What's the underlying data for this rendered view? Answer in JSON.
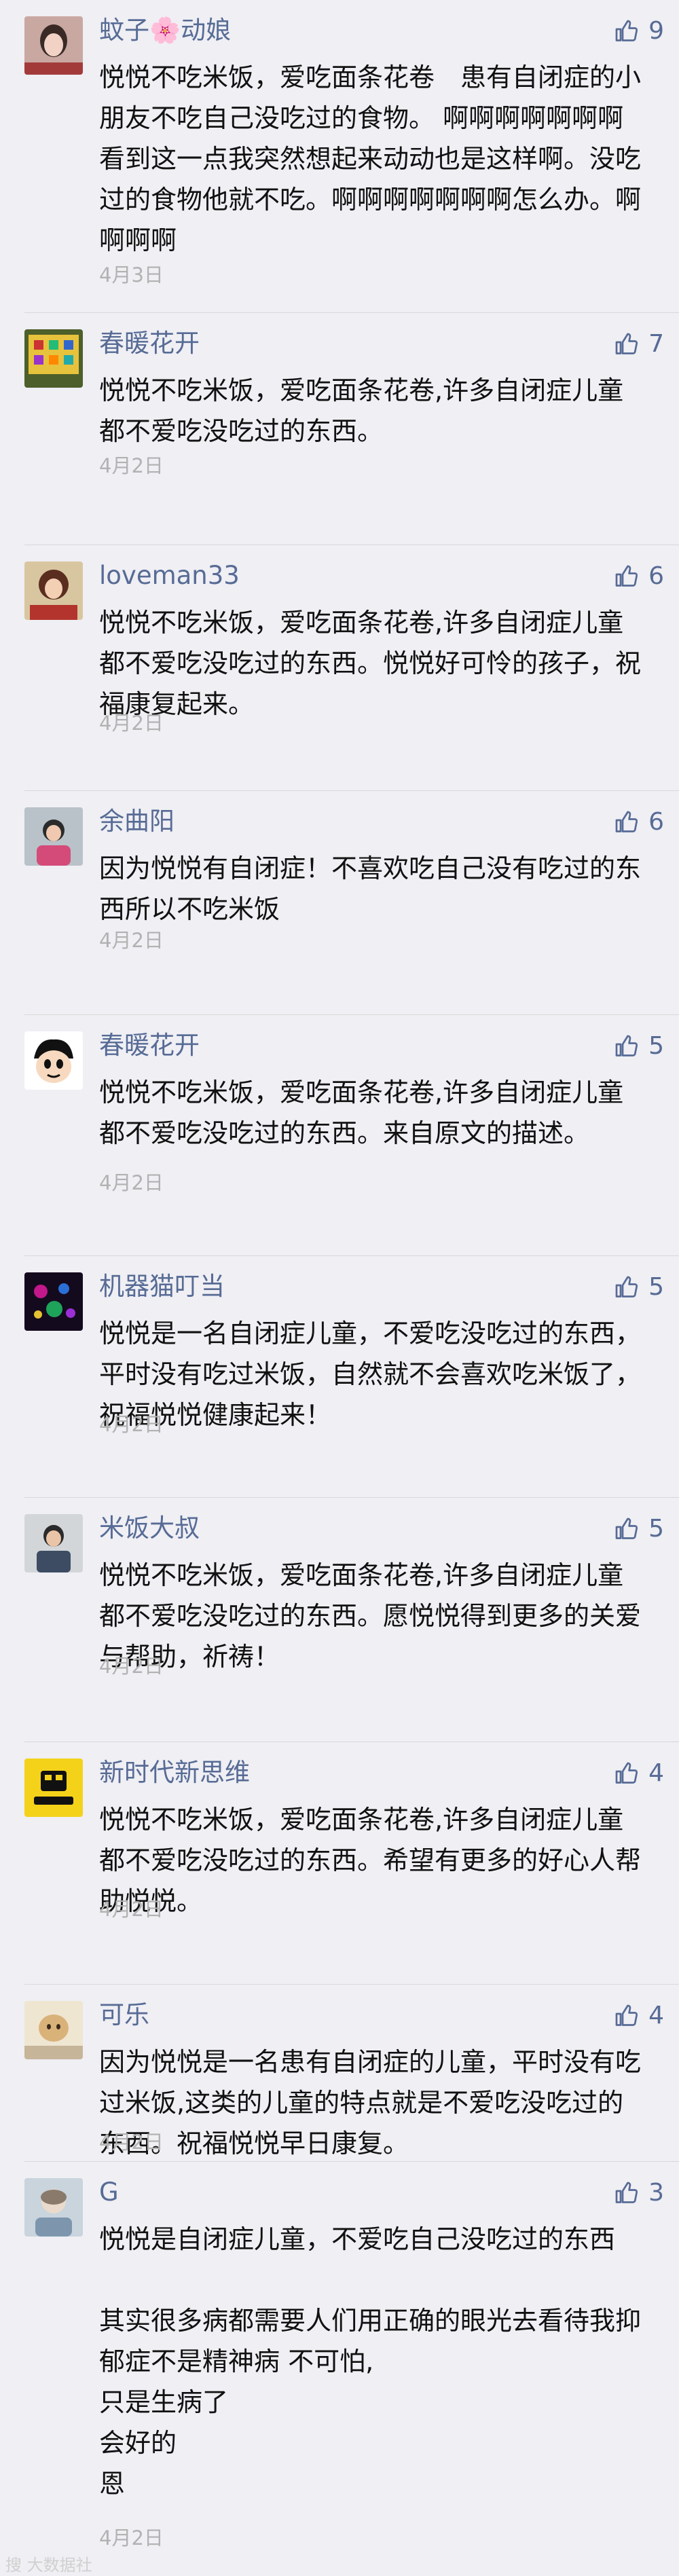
{
  "comments": [
    {
      "name": "蚊子🌸动娘",
      "likes": "9",
      "date": "4月3日",
      "text": "悦悦不吃米饭，爱吃面条花卷　患有自闭症的小朋友不吃自己没吃过的食物。 啊啊啊啊啊啊啊看到这一点我突然想起来动动也是这样啊。没吃过的食物他就不吃。啊啊啊啊啊啊啊怎么办。啊啊啊啊"
    },
    {
      "name": "春暖花开",
      "likes": "7",
      "date": "4月2日",
      "text": "悦悦不吃米饭，爱吃面条花卷,许多自闭症儿童都不爱吃没吃过的东西。"
    },
    {
      "name": "loveman33",
      "likes": "6",
      "date": "4月2日",
      "text": "悦悦不吃米饭，爱吃面条花卷,许多自闭症儿童都不爱吃没吃过的东西。悦悦好可怜的孩子，祝福康复起来。"
    },
    {
      "name": "余曲阳",
      "likes": "6",
      "date": "4月2日",
      "text": "因为悦悦有自闭症！不喜欢吃自己没有吃过的东西所以不吃米饭"
    },
    {
      "name": "春暖花开",
      "likes": "5",
      "date": "4月2日",
      "text": "悦悦不吃米饭，爱吃面条花卷,许多自闭症儿童都不爱吃没吃过的东西。来自原文的描述。"
    },
    {
      "name": "机器猫叮当",
      "likes": "5",
      "date": "4月2日",
      "text": "悦悦是一名自闭症儿童，不爱吃没吃过的东西，平时没有吃过米饭，自然就不会喜欢吃米饭了，祝福悦悦健康起来！"
    },
    {
      "name": "米饭大叔",
      "likes": "5",
      "date": "4月2日",
      "text": "悦悦不吃米饭，爱吃面条花卷,许多自闭症儿童都不爱吃没吃过的东西。愿悦悦得到更多的关爱与帮助，祈祷！"
    },
    {
      "name": "新时代新思维",
      "likes": "4",
      "date": "4月2日",
      "text": "悦悦不吃米饭，爱吃面条花卷,许多自闭症儿童都不爱吃没吃过的东西。希望有更多的好心人帮助悦悦。"
    },
    {
      "name": "可乐",
      "likes": "4",
      "date": "4月2日",
      "text": "因为悦悦是一名患有自闭症的儿童，平时没有吃过米饭,这类的儿童的特点就是不爱吃没吃过的东西。祝福悦悦早日康复。"
    },
    {
      "name": "G",
      "likes": "3",
      "date": "4月2日",
      "text": "悦悦是自闭症儿童，不爱吃自己没吃过的东西\n\n其实很多病都需要人们用正确的眼光去看待我抑郁症不是精神病 不可怕,\n只是生病了\n会好的\n恩"
    }
  ],
  "watermark": "搜 大数据社"
}
